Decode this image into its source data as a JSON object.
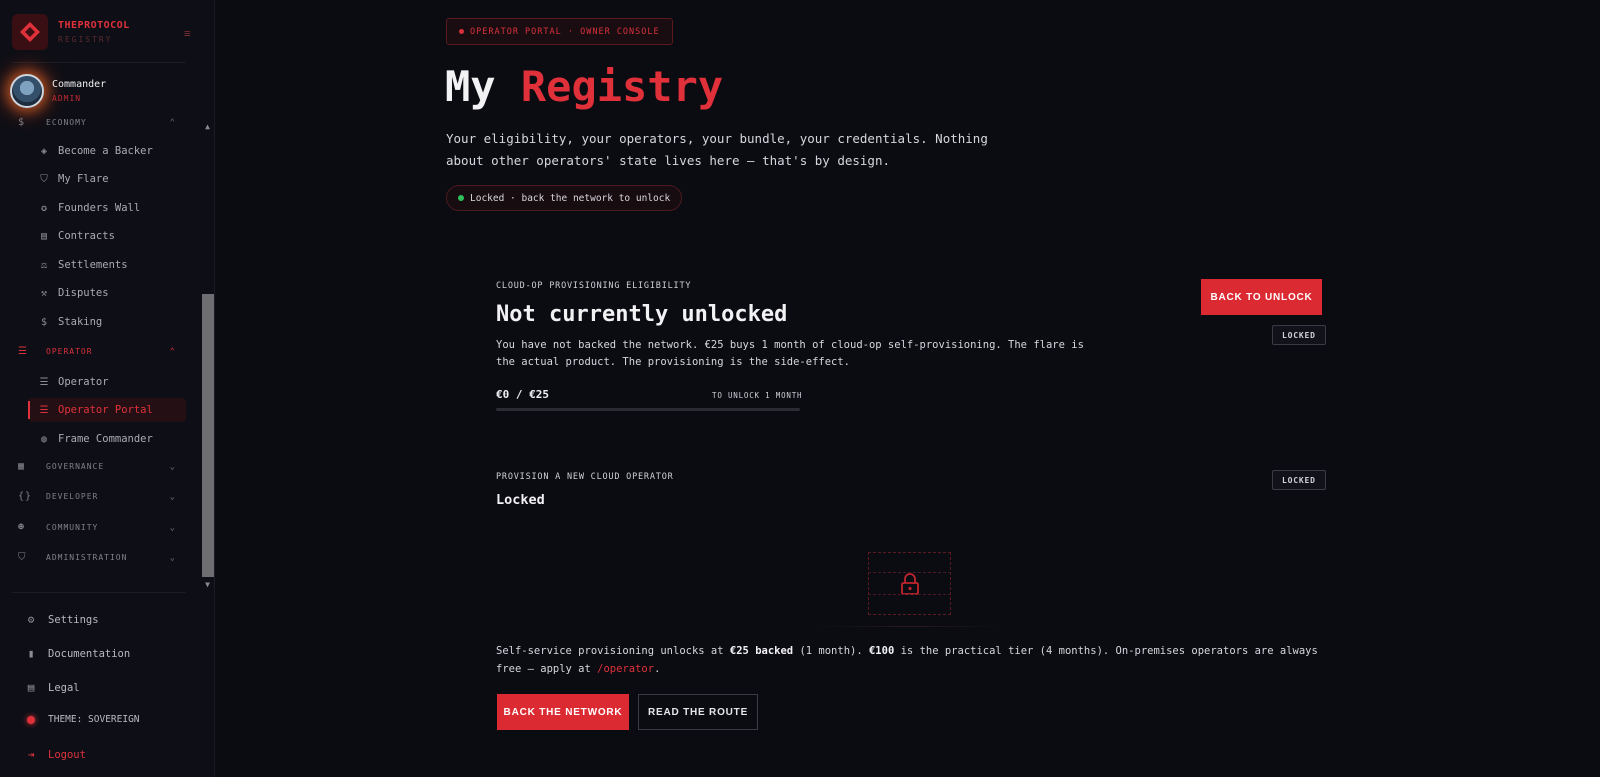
{
  "brand": {
    "name": "THEPROTOCOL",
    "sub": "REGISTRY"
  },
  "user": {
    "name": "Commander",
    "role": "ADMIN"
  },
  "sidebar": {
    "sections": [
      {
        "label": "ECONOMY",
        "icon": "dollar-icon"
      },
      {
        "label": "OPERATOR",
        "icon": "server-icon"
      },
      {
        "label": "GOVERNANCE",
        "icon": "building-icon"
      },
      {
        "label": "DEVELOPER",
        "icon": "braces-icon"
      },
      {
        "label": "COMMUNITY",
        "icon": "users-icon"
      },
      {
        "label": "ADMINISTRATION",
        "icon": "shield-icon"
      }
    ],
    "economy_items": [
      {
        "label": "Become a Backer",
        "icon": "coins-icon"
      },
      {
        "label": "My Flare",
        "icon": "shield-icon"
      },
      {
        "label": "Founders Wall",
        "icon": "medal-icon"
      },
      {
        "label": "Contracts",
        "icon": "file-icon"
      },
      {
        "label": "Settlements",
        "icon": "scale-icon"
      },
      {
        "label": "Disputes",
        "icon": "gavel-icon"
      },
      {
        "label": "Staking",
        "icon": "dollar-icon"
      }
    ],
    "operator_items": [
      {
        "label": "Operator",
        "icon": "server-icon"
      },
      {
        "label": "Operator Portal",
        "icon": "server-icon"
      },
      {
        "label": "Frame Commander",
        "icon": "globe-icon"
      }
    ],
    "bottom": {
      "settings": "Settings",
      "documentation": "Documentation",
      "legal": "Legal",
      "theme": "THEME: SOVEREIGN",
      "logout": "Logout"
    }
  },
  "header": {
    "pill": "OPERATOR PORTAL · OWNER CONSOLE",
    "title_plain": "My",
    "title_accent": "Registry",
    "lede": "Your eligibility, your operators, your bundle, your credentials. Nothing about other operators' state lives here — that's by design.",
    "status": "Locked · back the network to unlock"
  },
  "eligibility": {
    "eyebrow": "CLOUD-OP PROVISIONING ELIGIBILITY",
    "title": "Not currently unlocked",
    "body": "You have not backed the network. €25 buys 1 month of cloud-op self-provisioning. The flare is the actual product. The provisioning is the side-effect.",
    "button": "BACK TO UNLOCK",
    "tag": "LOCKED",
    "amount": "€0 / €25",
    "note": "TO UNLOCK 1 MONTH",
    "progress": 0
  },
  "provision": {
    "eyebrow": "PROVISION A NEW CLOUD OPERATOR",
    "title": "Locked",
    "tag": "LOCKED"
  },
  "footnote": {
    "p1": "Self-service provisioning unlocks at ",
    "b1": "€25 backed",
    "p2": " (1 month). ",
    "b2": "€100",
    "p3": " is the practical tier (4 months). On-premises operators are always free — apply at ",
    "link": "/operator",
    "p4": "."
  },
  "actions": {
    "primary": "BACK THE NETWORK",
    "secondary": "READ THE ROUTE"
  },
  "colors": {
    "accent": "#e0313b",
    "bg": "#0b0b12",
    "status_ok": "#2fbf5a"
  }
}
